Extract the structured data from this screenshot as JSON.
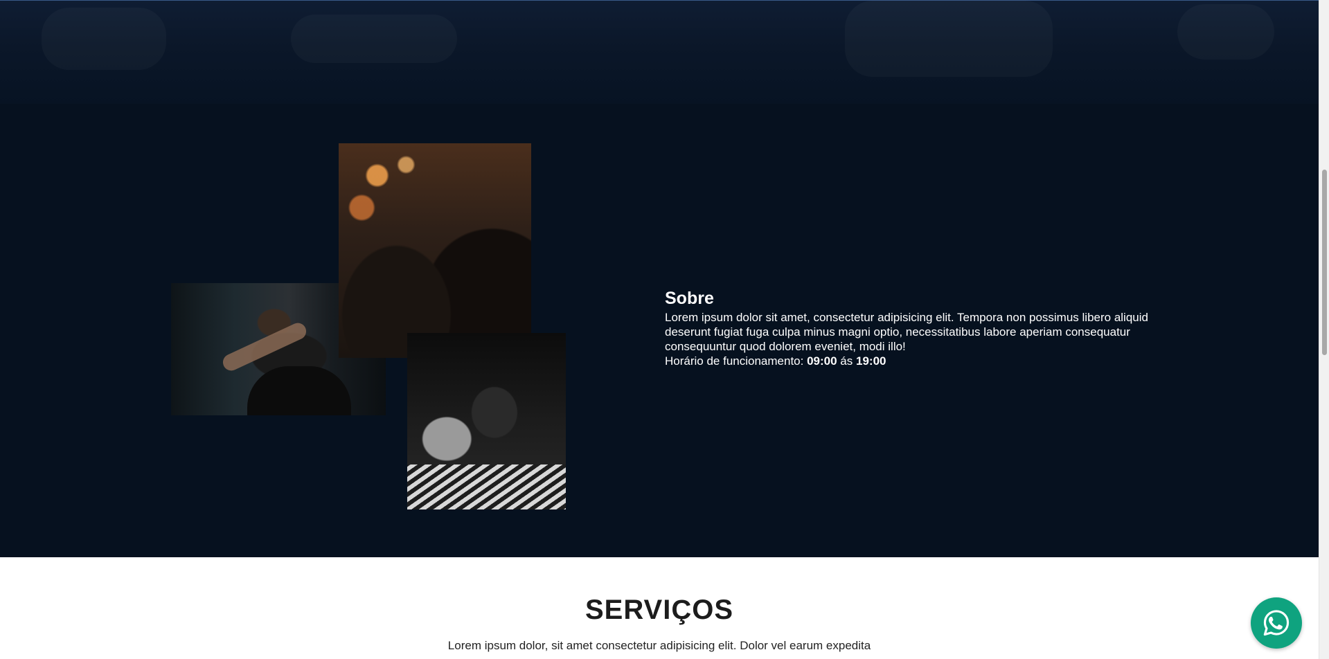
{
  "about": {
    "title": "Sobre",
    "body": "Lorem ipsum dolor sit amet, consectetur adipisicing elit. Tempora non possimus libero aliquid deserunt fugiat fuga culpa minus magni optio, necessitatibus labore aperiam consequatur consequuntur quod dolorem eveniet, modi illo!",
    "hours_label": "Horário de funcionamento:",
    "hours_open": "09:00",
    "hours_sep": "ás",
    "hours_close": "19:00",
    "photos": [
      "barber-cutting-hair-photo",
      "barbershop-interior-photo",
      "beard-trim-photo"
    ]
  },
  "services": {
    "title": "SERVIÇOS",
    "description": "Lorem ipsum dolor, sit amet consectetur adipisicing elit. Dolor vel earum expedita"
  },
  "whatsapp": {
    "icon": "whatsapp-icon",
    "color": "#0fa37f"
  },
  "colors": {
    "about_bg": "#06111f",
    "services_bg": "#ffffff",
    "text_light": "#ffffff",
    "text_dark": "#1c1c1c"
  }
}
